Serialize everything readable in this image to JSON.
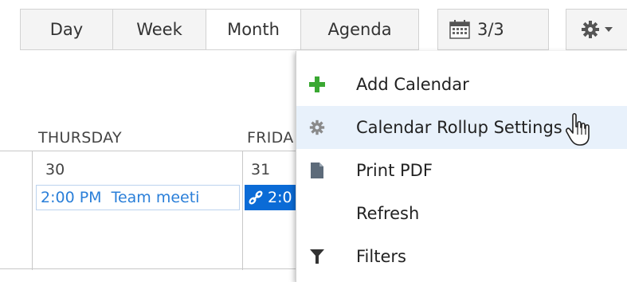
{
  "toolbar": {
    "views": [
      "Day",
      "Week",
      "Month",
      "Agenda"
    ],
    "active_view": "Month",
    "calendar_count": "3/3"
  },
  "calendar": {
    "day_headers": [
      "THURSDAY",
      "FRIDA"
    ],
    "day_numbers": [
      "30",
      "31"
    ],
    "events": [
      {
        "time": "2:00 PM",
        "title": "Team meeti"
      },
      {
        "time": "2:0",
        "title": ""
      }
    ]
  },
  "menu": {
    "items": [
      {
        "label": "Add Calendar",
        "icon": "plus-icon"
      },
      {
        "label": "Calendar Rollup Settings",
        "icon": "gear-icon"
      },
      {
        "label": "Print PDF",
        "icon": "document-icon"
      },
      {
        "label": "Refresh",
        "icon": ""
      },
      {
        "label": "Filters",
        "icon": "funnel-icon"
      }
    ],
    "hovered_index": 1
  },
  "colors": {
    "accent": "#0b6bd6",
    "event_text": "#2a7fd9",
    "hover_bg": "#e8f1fb",
    "add_green": "#3aa832"
  }
}
